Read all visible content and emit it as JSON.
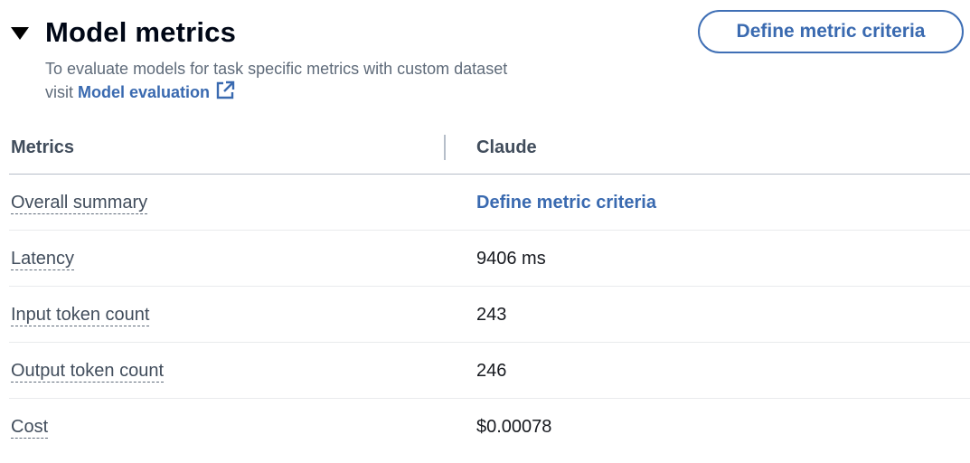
{
  "section": {
    "title": "Model metrics",
    "toggle_icon": "caret-down-icon",
    "description_line1": "To evaluate models for task specific metrics with custom dataset",
    "description_prefix": "visit",
    "description_link": "Model evaluation",
    "link_icon": "external-link-icon",
    "define_button_label": "Define metric criteria"
  },
  "table": {
    "headers": {
      "metrics": "Metrics",
      "model": "Claude"
    },
    "rows": [
      {
        "label": "Overall summary",
        "value": "Define metric criteria"
      },
      {
        "label": "Latency",
        "value": "9406 ms"
      },
      {
        "label": "Input token count",
        "value": "243"
      },
      {
        "label": "Output token count",
        "value": "246"
      },
      {
        "label": "Cost",
        "value": "$0.00078"
      }
    ]
  },
  "colors": {
    "accent": "#3a6ab0",
    "heading": "#000716",
    "label": "#414d5c",
    "description": "#5f6b7a",
    "divider": "#b6bec9"
  }
}
